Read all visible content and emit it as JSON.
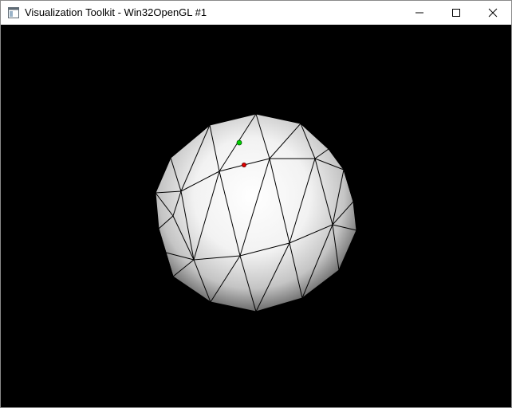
{
  "window": {
    "title": "Visualization Toolkit - Win32OpenGL #1",
    "icon": "vtk-window-icon",
    "controls": [
      "minimize",
      "maximize",
      "close"
    ]
  },
  "viewport": {
    "background": "#000000",
    "sphere_shade_light": "#ffffff",
    "sphere_shade_dark": "#4a4a4a",
    "edge_color": "#000000"
  },
  "markers": [
    {
      "name": "green-point",
      "color": "#00d000"
    },
    {
      "name": "red-point",
      "color": "#e00000"
    }
  ]
}
